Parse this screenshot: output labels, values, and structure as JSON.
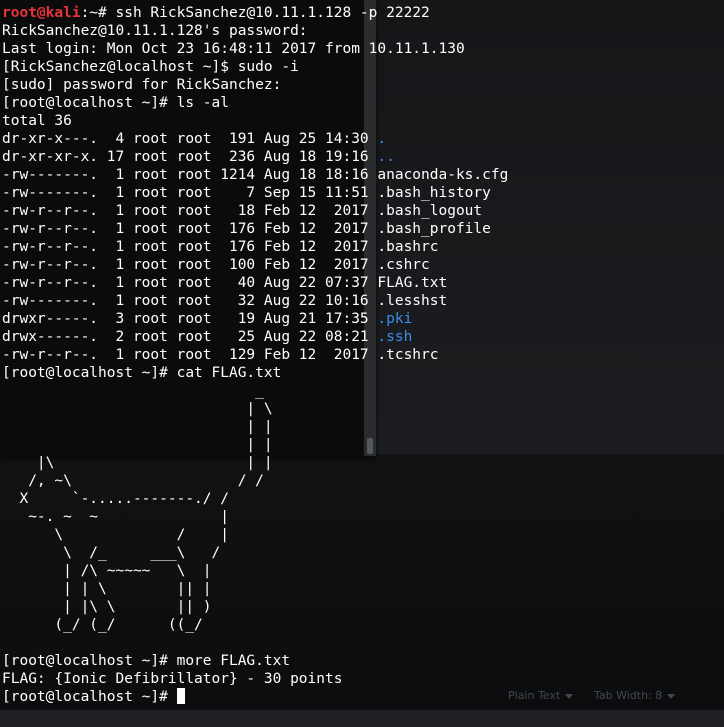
{
  "terminal": {
    "lines": [
      {
        "segs": [
          {
            "t": "root@kali",
            "c": "red"
          },
          {
            "t": ":~# ssh RickSanchez@10.11.1.128 -p 22222",
            "c": "white"
          }
        ]
      },
      {
        "segs": [
          {
            "t": "RickSanchez@10.11.1.128's password:",
            "c": "white"
          }
        ]
      },
      {
        "segs": [
          {
            "t": "Last login: Mon Oct 23 16:48:11 2017 from 10.11.1.130",
            "c": "white"
          }
        ]
      },
      {
        "segs": [
          {
            "t": "[RickSanchez@localhost ~]$ sudo -i",
            "c": "white"
          }
        ]
      },
      {
        "segs": [
          {
            "t": "[sudo] password for RickSanchez:",
            "c": "white"
          }
        ]
      },
      {
        "segs": [
          {
            "t": "[root@localhost ~]# ls -al",
            "c": "white"
          }
        ]
      },
      {
        "segs": [
          {
            "t": "total 36",
            "c": "white"
          }
        ]
      },
      {
        "segs": [
          {
            "t": "dr-xr-x---.  4 root root  191 Aug 25 14:30 ",
            "c": "white"
          },
          {
            "t": ".",
            "c": "blue"
          }
        ]
      },
      {
        "segs": [
          {
            "t": "dr-xr-xr-x. 17 root root  236 Aug 18 19:16 ",
            "c": "white"
          },
          {
            "t": "..",
            "c": "blue"
          }
        ]
      },
      {
        "segs": [
          {
            "t": "-rw-------.  1 root root 1214 Aug 18 18:16 anaconda-ks.cfg",
            "c": "white"
          }
        ]
      },
      {
        "segs": [
          {
            "t": "-rw-------.  1 root root    7 Sep 15 11:51 .bash_history",
            "c": "white"
          }
        ]
      },
      {
        "segs": [
          {
            "t": "-rw-r--r--.  1 root root   18 Feb 12  2017 .bash_logout",
            "c": "white"
          }
        ]
      },
      {
        "segs": [
          {
            "t": "-rw-r--r--.  1 root root  176 Feb 12  2017 .bash_profile",
            "c": "white"
          }
        ]
      },
      {
        "segs": [
          {
            "t": "-rw-r--r--.  1 root root  176 Feb 12  2017 .bashrc",
            "c": "white"
          }
        ]
      },
      {
        "segs": [
          {
            "t": "-rw-r--r--.  1 root root  100 Feb 12  2017 .cshrc",
            "c": "white"
          }
        ]
      },
      {
        "segs": [
          {
            "t": "-rw-r--r--.  1 root root   40 Aug 22 07:37 FLAG.txt",
            "c": "white"
          }
        ]
      },
      {
        "segs": [
          {
            "t": "-rw-------.  1 root root   32 Aug 22 10:16 .lesshst",
            "c": "white"
          }
        ]
      },
      {
        "segs": [
          {
            "t": "drwxr-----.  3 root root   19 Aug 21 17:35 ",
            "c": "white"
          },
          {
            "t": ".pki",
            "c": "blue"
          }
        ]
      },
      {
        "segs": [
          {
            "t": "drwx------.  2 root root   25 Aug 22 08:21 ",
            "c": "white"
          },
          {
            "t": ".ssh",
            "c": "blue"
          }
        ]
      },
      {
        "segs": [
          {
            "t": "-rw-r--r--.  1 root root  129 Feb 12  2017 .tcshrc",
            "c": "white"
          }
        ]
      },
      {
        "segs": [
          {
            "t": "[root@localhost ~]# cat FLAG.txt",
            "c": "white"
          }
        ]
      },
      {
        "segs": [
          {
            "t": "                             _",
            "c": "white"
          }
        ]
      },
      {
        "segs": [
          {
            "t": "                            | \\",
            "c": "white"
          }
        ]
      },
      {
        "segs": [
          {
            "t": "                            | |",
            "c": "white"
          }
        ]
      },
      {
        "segs": [
          {
            "t": "                            | |",
            "c": "white"
          }
        ]
      },
      {
        "segs": [
          {
            "t": "    |\\                      | |",
            "c": "white"
          }
        ]
      },
      {
        "segs": [
          {
            "t": "   /, ~\\                   / /",
            "c": "white"
          }
        ]
      },
      {
        "segs": [
          {
            "t": "  X     `-.....-------./ /",
            "c": "white"
          }
        ]
      },
      {
        "segs": [
          {
            "t": "   ~-. ~  ~              |",
            "c": "white"
          }
        ]
      },
      {
        "segs": [
          {
            "t": "      \\             /    |",
            "c": "white"
          }
        ]
      },
      {
        "segs": [
          {
            "t": "       \\  /_     ___\\   /",
            "c": "white"
          }
        ]
      },
      {
        "segs": [
          {
            "t": "       | /\\ ~~~~~   \\  |",
            "c": "white"
          }
        ]
      },
      {
        "segs": [
          {
            "t": "       | | \\        || |",
            "c": "white"
          }
        ]
      },
      {
        "segs": [
          {
            "t": "       | |\\ \\       || )",
            "c": "white"
          }
        ]
      },
      {
        "segs": [
          {
            "t": "      (_/ (_/      ((_/",
            "c": "white"
          }
        ]
      },
      {
        "segs": [
          {
            "t": "",
            "c": "white"
          }
        ]
      },
      {
        "segs": [
          {
            "t": "[root@localhost ~]# more FLAG.txt",
            "c": "white"
          }
        ]
      },
      {
        "segs": [
          {
            "t": "FLAG: {Ionic Defibrillator} - 30 points",
            "c": "white"
          }
        ]
      },
      {
        "segs": [
          {
            "t": "[root@localhost ~]# ",
            "c": "white"
          }
        ],
        "cursor": true
      }
    ]
  },
  "status_bar": {
    "syntax_label": "Plain Text",
    "tab_width_label": "Tab Width: 8"
  },
  "colors": {
    "prompt_red": "#e8343b",
    "directory_blue": "#3b8eea",
    "text": "#ffffff",
    "background": "#000000"
  }
}
